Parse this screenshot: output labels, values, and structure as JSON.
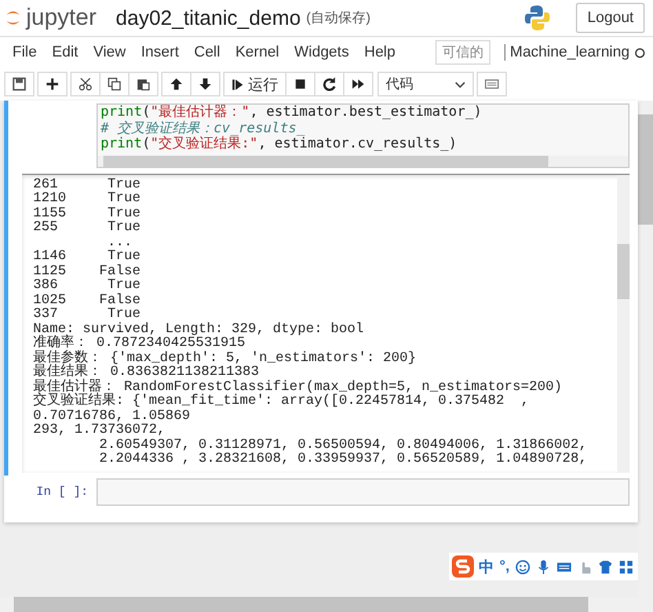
{
  "header": {
    "logo_text": "jupyter",
    "notebook_title": "day02_titanic_demo",
    "autosave": "(自动保存)",
    "logout": "Logout"
  },
  "menu": {
    "items": [
      "File",
      "Edit",
      "View",
      "Insert",
      "Cell",
      "Kernel",
      "Widgets",
      "Help"
    ],
    "trusted": "可信的",
    "kernel_name": "Machine_learning",
    "kernel_busy": false
  },
  "toolbar": {
    "run_label": "运行",
    "cell_type": "代码"
  },
  "cells": [
    {
      "focused": true,
      "code_lines": [
        [
          {
            "kind": "builtin",
            "text": "print"
          },
          {
            "kind": "plain",
            "text": "("
          },
          {
            "kind": "string",
            "text": "\"最佳估计器：\""
          },
          {
            "kind": "plain",
            "text": ", estimator.best_estimator_)"
          }
        ],
        [
          {
            "kind": "comment",
            "text": "# 交叉验证结果：cv_results_"
          }
        ],
        [
          {
            "kind": "builtin",
            "text": "print"
          },
          {
            "kind": "plain",
            "text": "("
          },
          {
            "kind": "string",
            "text": "\"交叉验证结果:\""
          },
          {
            "kind": "plain",
            "text": ", estimator.cv_results_)"
          }
        ]
      ],
      "output": [
        "261      True",
        "1210     True",
        "1155     True",
        "255      True",
        "         ...",
        "1146     True",
        "1125    False",
        "386      True",
        "1025    False",
        "337      True",
        "Name: survived, Length: 329, dtype: bool",
        "准确率： 0.7872340425531915",
        "最佳参数： {'max_depth': 5, 'n_estimators': 200}",
        "最佳结果： 0.8363821138211383",
        "最佳估计器： RandomForestClassifier(max_depth=5, n_estimators=200)",
        "交叉验证结果: {'mean_fit_time': array([0.22457814, 0.375482  , 0.70716786, 1.05869",
        "293, 1.73736072,",
        "        2.60549307, 0.31128971, 0.56500594, 0.80494006, 1.31866002,",
        "        2.2044336 , 3.28321608, 0.33959937, 0.56520589, 1.04890728,"
      ]
    },
    {
      "prompt": "In  [ ]:",
      "focused": false
    }
  ],
  "ime_toolbar": {
    "mode": "中",
    "punctuation": "°,"
  }
}
